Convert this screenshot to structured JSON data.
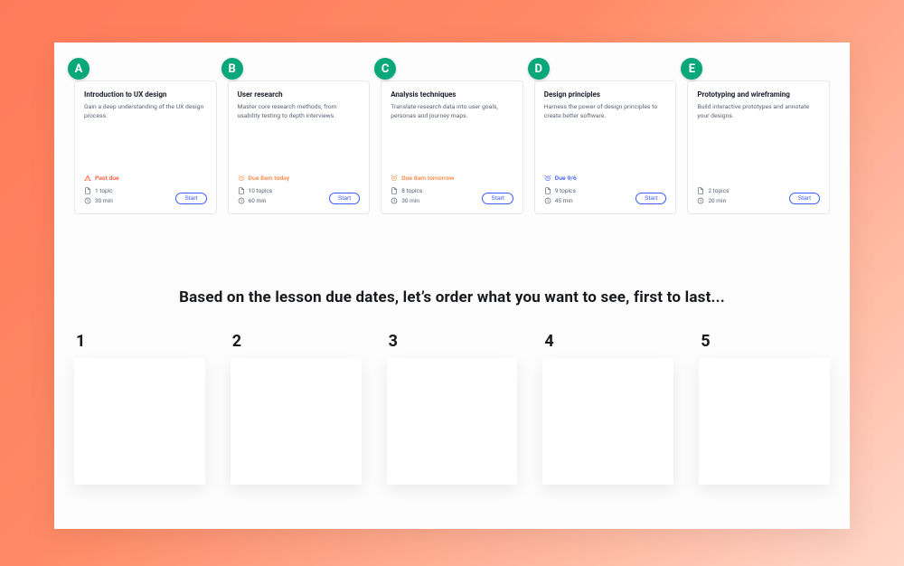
{
  "cards": [
    {
      "badge": "A",
      "title": "Introduction to UX design",
      "desc": "Gain a deep understanding of the UX design process.",
      "due_kind": "pastdue",
      "due_label": "Past due",
      "topics": "1 topic",
      "duration": "30 min",
      "start": "Start"
    },
    {
      "badge": "B",
      "title": "User research",
      "desc": "Master core research methods, from usability testing to depth interviews.",
      "due_kind": "today",
      "due_label": "Due 8am today",
      "topics": "10 topics",
      "duration": "60 min",
      "start": "Start"
    },
    {
      "badge": "C",
      "title": "Analysis techniques",
      "desc": "Translate research data into user goals, personas and journey maps.",
      "due_kind": "tomorrow",
      "due_label": "Due 8am tomorrow",
      "topics": "8 topics",
      "duration": "30 min",
      "start": "Start"
    },
    {
      "badge": "D",
      "title": "Design principles",
      "desc": "Harness the power of design principles to create better software.",
      "due_kind": "date",
      "due_label": "Due 9/6",
      "topics": "9 topics",
      "duration": "45 min",
      "start": "Start"
    },
    {
      "badge": "E",
      "title": "Prototyping and wireframing",
      "desc": "Build interactive prototypes and annotate your designs.",
      "due_kind": "none",
      "due_label": "",
      "topics": "2 topics",
      "duration": "20 min",
      "start": "Start"
    }
  ],
  "prompt": "Based on the lesson due dates, let’s order what you want to see, first to last...",
  "slots": [
    "1",
    "2",
    "3",
    "4",
    "5"
  ]
}
